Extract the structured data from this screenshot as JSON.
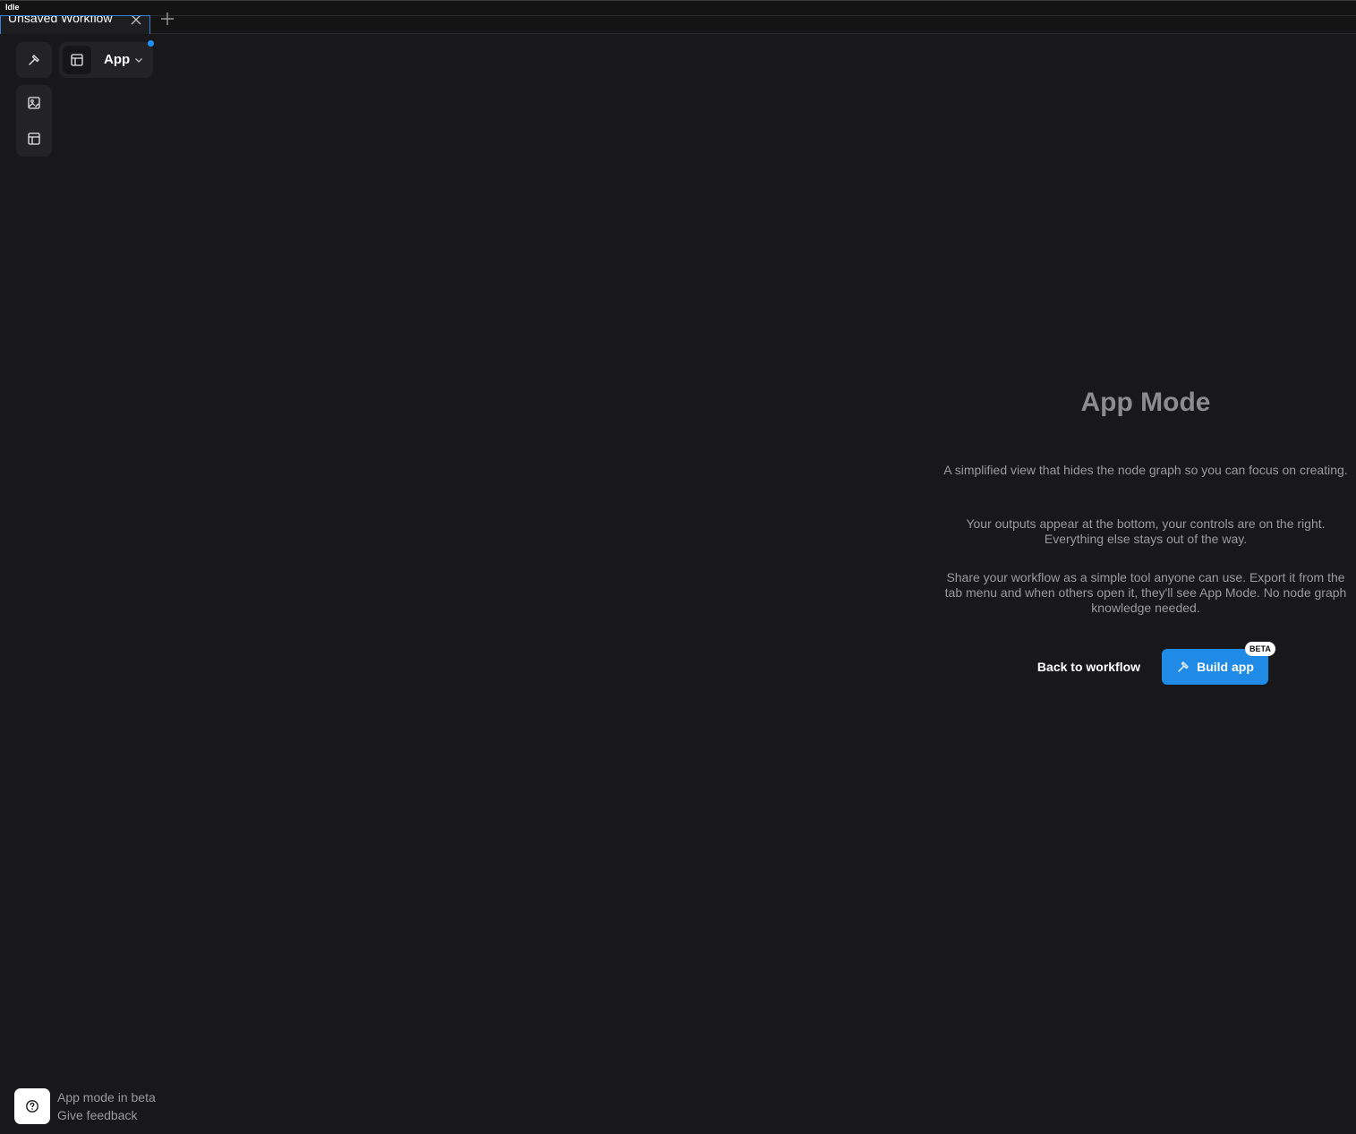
{
  "status": {
    "label": "Idle"
  },
  "tabs": [
    {
      "title": "Unsaved Workflow",
      "active": true
    }
  ],
  "toolbar": {
    "mode_label": "App",
    "icons": [
      "hammer-icon",
      "image-edit-icon",
      "layout-icon"
    ]
  },
  "empty_state": {
    "title": "App Mode",
    "paragraphs": [
      "A simplified view that hides the node graph so you can focus on creating.",
      "Your outputs appear at the bottom, your controls are on the right. Everything else stays out of the way.",
      "Share your workflow as a simple tool anyone can use. Export it from the tab menu and when others open it, they'll see App Mode. No node graph knowledge needed."
    ],
    "back_label": "Back to workflow",
    "build_label": "Build app",
    "badge": "BETA"
  },
  "footer": {
    "line1": "App mode in beta",
    "line2": "Give feedback"
  },
  "colors": {
    "background": "#18181a",
    "accent": "#1f8be6",
    "panel": "#232326"
  }
}
